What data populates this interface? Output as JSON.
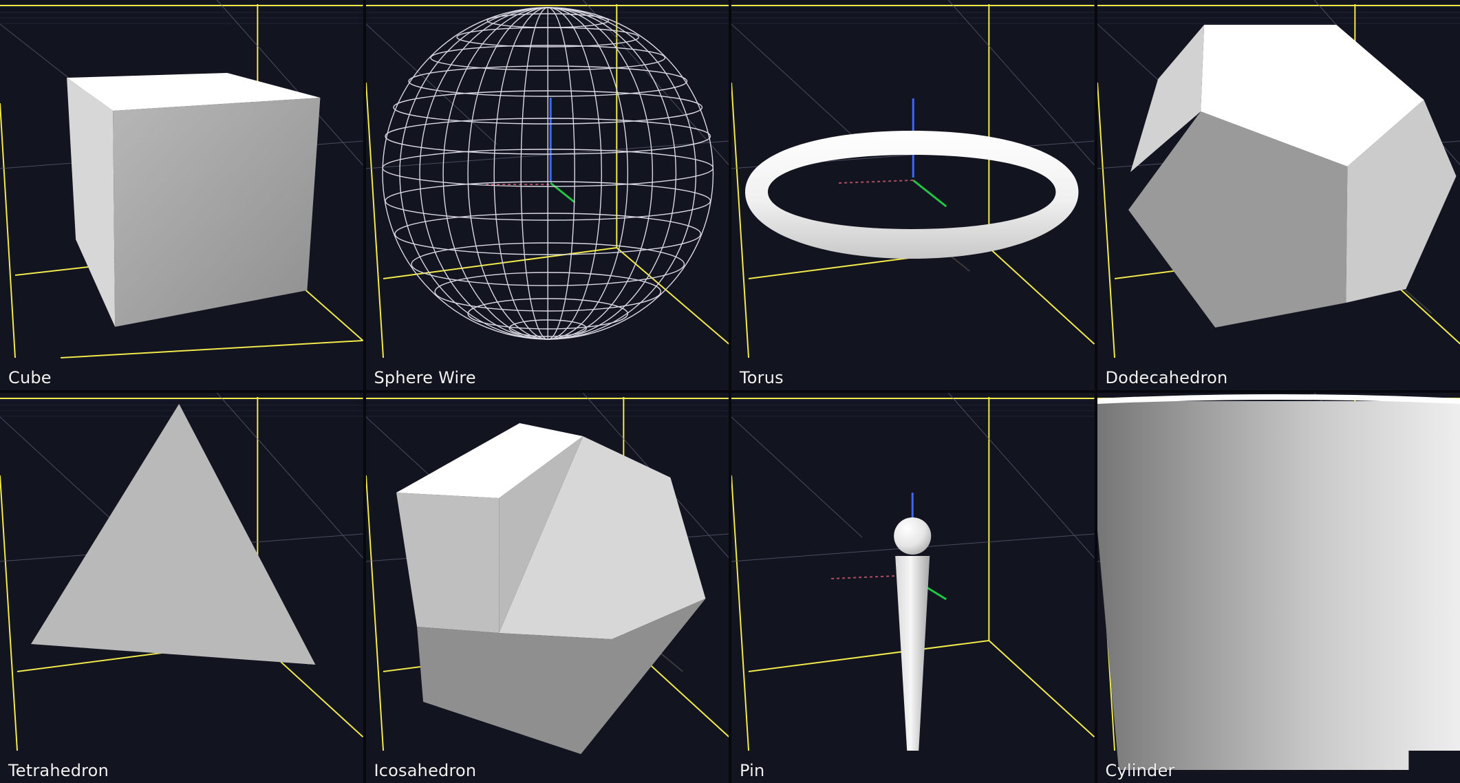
{
  "viewports": [
    {
      "label": "Cube"
    },
    {
      "label": "Sphere Wire"
    },
    {
      "label": "Torus"
    },
    {
      "label": "Dodecahedron"
    },
    {
      "label": "Tetrahedron"
    },
    {
      "label": "Icosahedron"
    },
    {
      "label": "Pin"
    },
    {
      "label": "Cylinder"
    }
  ],
  "colors": {
    "background": "#121420",
    "grid": "#f2e94a",
    "axis_blue": "#3d65ff",
    "axis_green": "#20d03c",
    "axis_red": "#b04f62",
    "shape": "#f2f2f2"
  }
}
